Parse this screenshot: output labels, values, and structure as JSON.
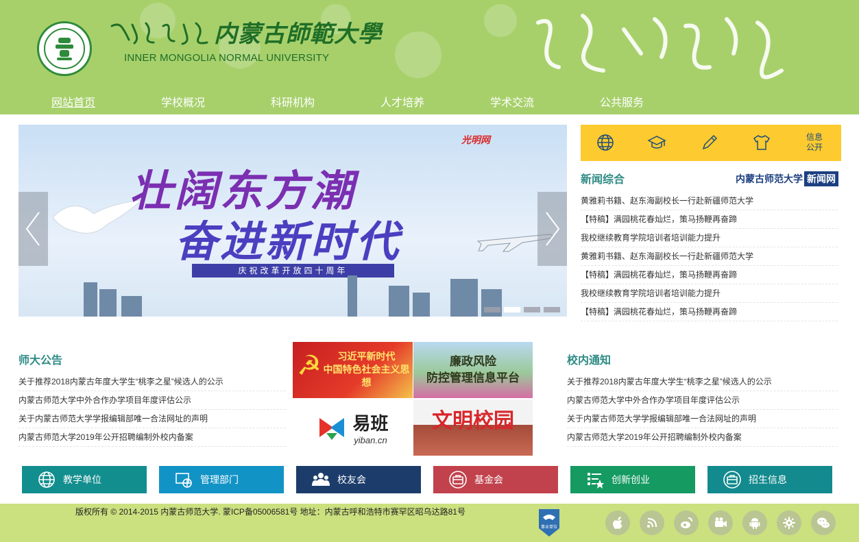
{
  "header": {
    "logo_cn": "内蒙古師範大學",
    "logo_en": "INNER MONGOLIA NORMAL UNIVERSITY"
  },
  "nav": [
    {
      "label": "网站首页"
    },
    {
      "label": "学校概况"
    },
    {
      "label": "科研机构"
    },
    {
      "label": "人才培养"
    },
    {
      "label": "学术交流"
    },
    {
      "label": "公共服务"
    }
  ],
  "slider": {
    "source": "光明网",
    "headline_1": "壮阔东方潮",
    "headline_2": "奋进新时代",
    "banner": "庆祝改革开放四十周年",
    "active_slide": 1,
    "slides": 4
  },
  "quick": {
    "info_line1": "信息",
    "info_line2": "公开"
  },
  "news": {
    "title": "新闻综合",
    "logo_text": "内蒙古师范大学",
    "logo_box": "新闻网",
    "items": [
      "黄雅莉书籍、赵东海副校长一行赴新疆师范大学",
      "【特稿】满园桃花春灿烂，策马扬鞭再奋蹄",
      "我校继续教育学院培训者培训能力提升",
      "黄雅莉书籍、赵东海副校长一行赴新疆师范大学",
      "【特稿】满园桃花春灿烂，策马扬鞭再奋蹄",
      "我校继续教育学院培训者培训能力提升",
      "【特稿】满园桃花春灿烂，策马扬鞭再奋蹄"
    ]
  },
  "announcements": {
    "title": "师大公告",
    "items": [
      "关于推荐2018内蒙古年度大学生“桃李之星”候选人的公示",
      "内蒙古师范大学中外合作办学项目年度评估公示",
      "关于内蒙古师范大学学报编辑部唯一合法网址的声明",
      "内蒙古师范大学2019年公开招聘编制外校内备案"
    ]
  },
  "notices": {
    "title": "校内通知",
    "items": [
      "关于推荐2018内蒙古年度大学生“桃李之星”候选人的公示",
      "内蒙古师范大学中外合作办学项目年度评估公示",
      "关于内蒙古师范大学学报编辑部唯一合法网址的声明",
      "内蒙古师范大学2019年公开招聘编制外校内备案"
    ]
  },
  "tiles": {
    "tile1_line1": "习近平新时代",
    "tile1_line2": "中国特色社会主义思想",
    "tile2_line1": "廉政风险",
    "tile2_line2": "防控管理信息平台",
    "tile3_title": "易班",
    "tile3_sub": "yiban.cn",
    "tile4_title": "文明校园"
  },
  "buttons": [
    {
      "label": "教学单位",
      "color": "#138e8e"
    },
    {
      "label": "管理部门",
      "color": "#1293c6"
    },
    {
      "label": "校友会",
      "color": "#1c3d6b"
    },
    {
      "label": "基金会",
      "color": "#c1424c"
    },
    {
      "label": "创新创业",
      "color": "#159a62"
    },
    {
      "label": "招生信息",
      "color": "#128a8e"
    }
  ],
  "footer": {
    "copyright": "版权所有 © 2014-2015 内蒙古师范大学. 蒙ICP备05006581号 地址：内蒙古呼和浩特市赛罕区昭乌达路81号",
    "badge_text": "事业单位"
  }
}
